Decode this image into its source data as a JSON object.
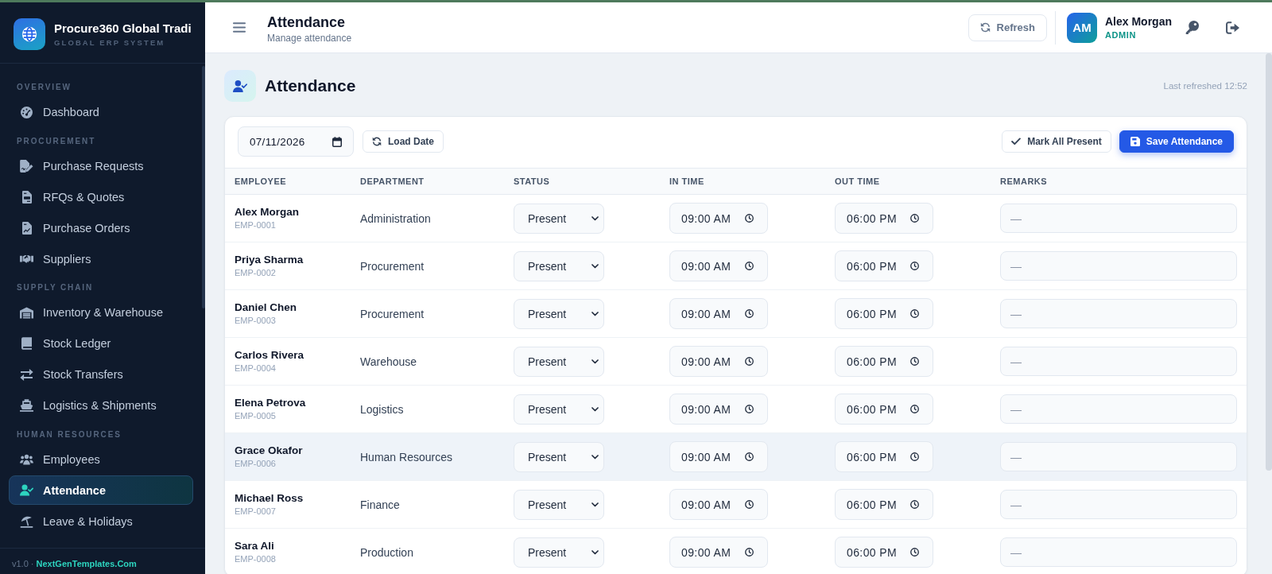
{
  "sidebar": {
    "brand": {
      "name": "Procure360 Global Tradi",
      "tagline": "GLOBAL ERP SYSTEM"
    },
    "sections": [
      {
        "label": "OVERVIEW",
        "items": [
          {
            "label": "Dashboard",
            "selected": false
          }
        ]
      },
      {
        "label": "PROCUREMENT",
        "items": [
          {
            "label": "Purchase Requests",
            "selected": false
          },
          {
            "label": "RFQs & Quotes",
            "selected": false
          },
          {
            "label": "Purchase Orders",
            "selected": false
          },
          {
            "label": "Suppliers",
            "selected": false
          }
        ]
      },
      {
        "label": "SUPPLY CHAIN",
        "items": [
          {
            "label": "Inventory & Warehouse",
            "selected": false
          },
          {
            "label": "Stock Ledger",
            "selected": false
          },
          {
            "label": "Stock Transfers",
            "selected": false
          },
          {
            "label": "Logistics & Shipments",
            "selected": false
          }
        ]
      },
      {
        "label": "HUMAN RESOURCES",
        "items": [
          {
            "label": "Employees",
            "selected": false
          },
          {
            "label": "Attendance",
            "selected": true
          },
          {
            "label": "Leave & Holidays",
            "selected": false
          }
        ]
      }
    ],
    "footer": {
      "version": "v1.0 ·",
      "link": "NextGenTemplates.Com"
    }
  },
  "header": {
    "title": "Attendance",
    "subtitle": "Manage attendance",
    "refresh_button": "Refresh",
    "user": {
      "initials": "AM",
      "name": "Alex Morgan",
      "role": "ADMIN"
    }
  },
  "page": {
    "title": "Attendance",
    "last_refreshed": "Last refreshed 12:52"
  },
  "toolbar": {
    "date": "07/11/2026",
    "load_button": "Load Date",
    "mark_all_button": "Mark All Present",
    "save_button": "Save Attendance"
  },
  "table": {
    "columns": [
      "EMPLOYEE",
      "DEPARTMENT",
      "STATUS",
      "IN TIME",
      "OUT TIME",
      "REMARKS"
    ],
    "rows": [
      {
        "name": "Alex Morgan",
        "id": "EMP-0001",
        "department": "Administration",
        "status": "Present",
        "in_time": "09:00 AM",
        "out_time": "06:00 PM",
        "remarks": {
          "placeholder": "—"
        },
        "highlighted": false
      },
      {
        "name": "Priya Sharma",
        "id": "EMP-0002",
        "department": "Procurement",
        "status": "Present",
        "in_time": "09:00 AM",
        "out_time": "06:00 PM",
        "remarks": {
          "placeholder": "—"
        },
        "highlighted": false
      },
      {
        "name": "Daniel Chen",
        "id": "EMP-0003",
        "department": "Procurement",
        "status": "Present",
        "in_time": "09:00 AM",
        "out_time": "06:00 PM",
        "remarks": {
          "placeholder": "—"
        },
        "highlighted": false
      },
      {
        "name": "Carlos Rivera",
        "id": "EMP-0004",
        "department": "Warehouse",
        "status": "Present",
        "in_time": "09:00 AM",
        "out_time": "06:00 PM",
        "remarks": {
          "placeholder": "—"
        },
        "highlighted": false
      },
      {
        "name": "Elena Petrova",
        "id": "EMP-0005",
        "department": "Logistics",
        "status": "Present",
        "in_time": "09:00 AM",
        "out_time": "06:00 PM",
        "remarks": {
          "placeholder": "—"
        },
        "highlighted": false
      },
      {
        "name": "Grace Okafor",
        "id": "EMP-0006",
        "department": "Human Resources",
        "status": "Present",
        "in_time": "09:00 AM",
        "out_time": "06:00 PM",
        "remarks": {
          "placeholder": "—"
        },
        "highlighted": true
      },
      {
        "name": "Michael Ross",
        "id": "EMP-0007",
        "department": "Finance",
        "status": "Present",
        "in_time": "09:00 AM",
        "out_time": "06:00 PM",
        "remarks": {
          "placeholder": "—"
        },
        "highlighted": false
      },
      {
        "name": "Sara Ali",
        "id": "EMP-0008",
        "department": "Production",
        "status": "Present",
        "in_time": "09:00 AM",
        "out_time": "06:00 PM",
        "remarks": {
          "placeholder": "—"
        },
        "highlighted": false
      }
    ]
  }
}
